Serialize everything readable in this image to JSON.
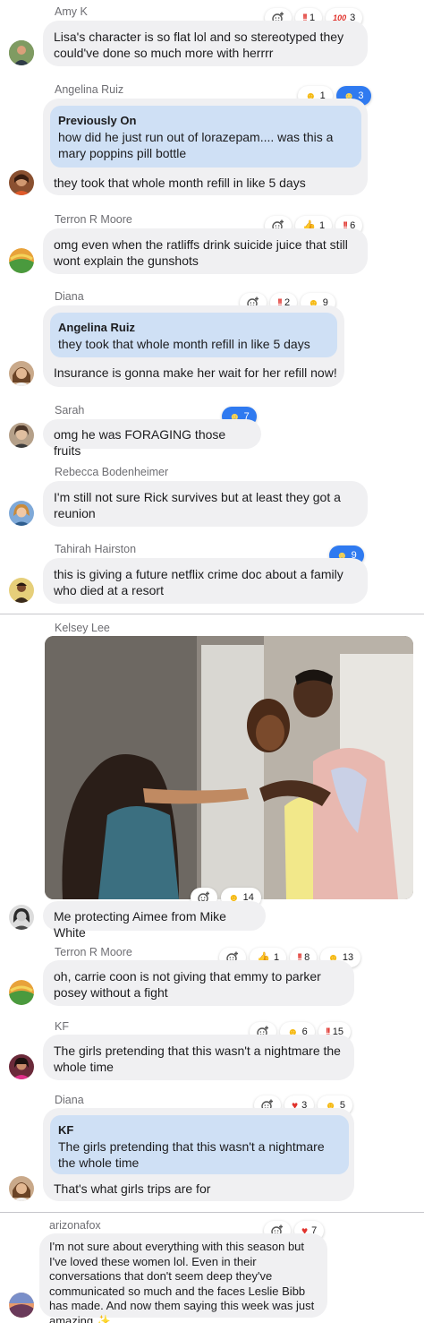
{
  "messages": [
    {
      "name": "Amy K",
      "text": "Lisa's character is so flat lol and so stereotyped they could've done so much more with herrrr",
      "reactions": [
        {
          "type": "bang",
          "count": "1"
        },
        {
          "type": "hundred",
          "count": "3"
        }
      ]
    },
    {
      "name": "Angelina Ruiz",
      "quote_name": "Previously On",
      "quote_text": "how did he just run out of lorazepam.... was this a mary poppins pill bottle",
      "text": "they took that whole month refill in like 5 days",
      "reactions": [
        {
          "type": "smile",
          "count": "1"
        },
        {
          "type": "smile",
          "count": "3",
          "active": true
        }
      ]
    },
    {
      "name": "Terron R Moore",
      "text": "omg even when the ratliffs drink suicide juice that still wont explain the gunshots",
      "reactions": [
        {
          "type": "thumb",
          "count": "1"
        },
        {
          "type": "bang",
          "count": "6"
        }
      ]
    },
    {
      "name": "Diana",
      "quote_name": "Angelina Ruiz",
      "quote_text": "they took that whole month refill in like 5 days",
      "text": "Insurance is gonna make her wait for her refill now!",
      "reactions": [
        {
          "type": "bang",
          "count": "2"
        },
        {
          "type": "smile",
          "count": "9"
        }
      ]
    },
    {
      "name": "Sarah",
      "text": "omg he was FORAGING those fruits",
      "reactions": [
        {
          "type": "smile",
          "count": "7",
          "active": true
        }
      ]
    },
    {
      "name": "Rebecca Bodenheimer",
      "text": "I'm still not sure Rick survives but at least they got a reunion",
      "reactions": []
    },
    {
      "name": "Tahirah Hairston",
      "text": "this is giving a future netflix crime doc about a family who died at a resort",
      "reactions": [
        {
          "type": "smile",
          "count": "9",
          "active": true
        }
      ]
    },
    {
      "name": "Kelsey Lee",
      "text": "Me protecting Aimee from Mike White",
      "reactions": [
        {
          "type": "smile",
          "count": "14"
        }
      ]
    },
    {
      "name": "Terron R Moore",
      "text": "oh, carrie coon is not giving that emmy to parker posey without a fight",
      "reactions": [
        {
          "type": "thumb",
          "count": "1"
        },
        {
          "type": "bang",
          "count": "8"
        },
        {
          "type": "smile",
          "count": "13"
        }
      ]
    },
    {
      "name": "KF",
      "text": "The girls pretending that this wasn't a nightmare the whole time",
      "reactions": [
        {
          "type": "smile",
          "count": "6"
        },
        {
          "type": "bang",
          "count": "15"
        }
      ]
    },
    {
      "name": "Diana",
      "quote_name": "KF",
      "quote_text": "The girls pretending that this wasn't a nightmare the whole time",
      "text": "That's what girls trips are for",
      "reactions": [
        {
          "type": "heart",
          "count": "3"
        },
        {
          "type": "smile",
          "count": "5"
        }
      ]
    },
    {
      "name": "arizonafox",
      "text": "I'm not sure about everything with this season but I've loved these women lol. Even in their conversations that don't seem deep they've communicated so much and the faces Leslie Bibb has made. And now them saying this week was just amazing",
      "text_suffix": "✨",
      "reactions": [
        {
          "type": "heart",
          "count": "7"
        }
      ]
    }
  ],
  "icons": {
    "add_reaction": "add-reaction-icon",
    "bang": "double-exclamation-icon",
    "hundred": "hundred-points-icon",
    "smile": "laughing-face-icon",
    "thumb": "thumbs-up-icon",
    "heart": "heart-icon",
    "sparkle": "sparkles-icon"
  },
  "colors": {
    "bubble": "#f0f0f2",
    "quote": "#cfe0f5",
    "active_reaction": "#2f7af0",
    "name": "#6e6e73"
  }
}
